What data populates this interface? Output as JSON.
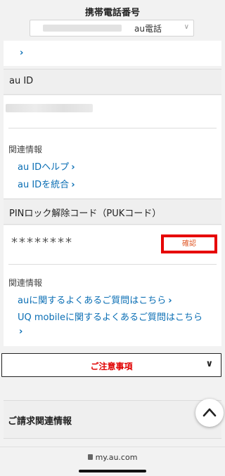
{
  "header": {
    "title": "携帯電話番号",
    "carrier": "au電話",
    "dropdown_icon": "chevron-down-icon"
  },
  "top_link": {
    "arrow": "›"
  },
  "au_id": {
    "section_title": "au ID",
    "related_label": "関連情報",
    "links": [
      {
        "label": "au IDヘルプ",
        "arrow": "›"
      },
      {
        "label": "au IDを統合",
        "arrow": "›"
      }
    ]
  },
  "puk": {
    "section_title": "PINロック解除コード（PUKコード）",
    "masked_value": "********",
    "confirm_label": "確認",
    "related_label": "関連情報",
    "links": [
      {
        "label": "auに関するよくあるご質問はこちら",
        "arrow": "›"
      },
      {
        "label": "UQ mobileに関するよくあるご質問はこちら",
        "arrow": "›"
      }
    ]
  },
  "notice": {
    "label": "ご注意事項",
    "icon": "chevron-down-icon"
  },
  "billing": {
    "label": "ご請求関連情報"
  },
  "scroll_top": {
    "icon": "chevron-up-icon"
  },
  "browser": {
    "url": "my.au.com",
    "icon": "lock-icon"
  },
  "colors": {
    "link": "#0a6eb4",
    "accent": "#e60000"
  }
}
